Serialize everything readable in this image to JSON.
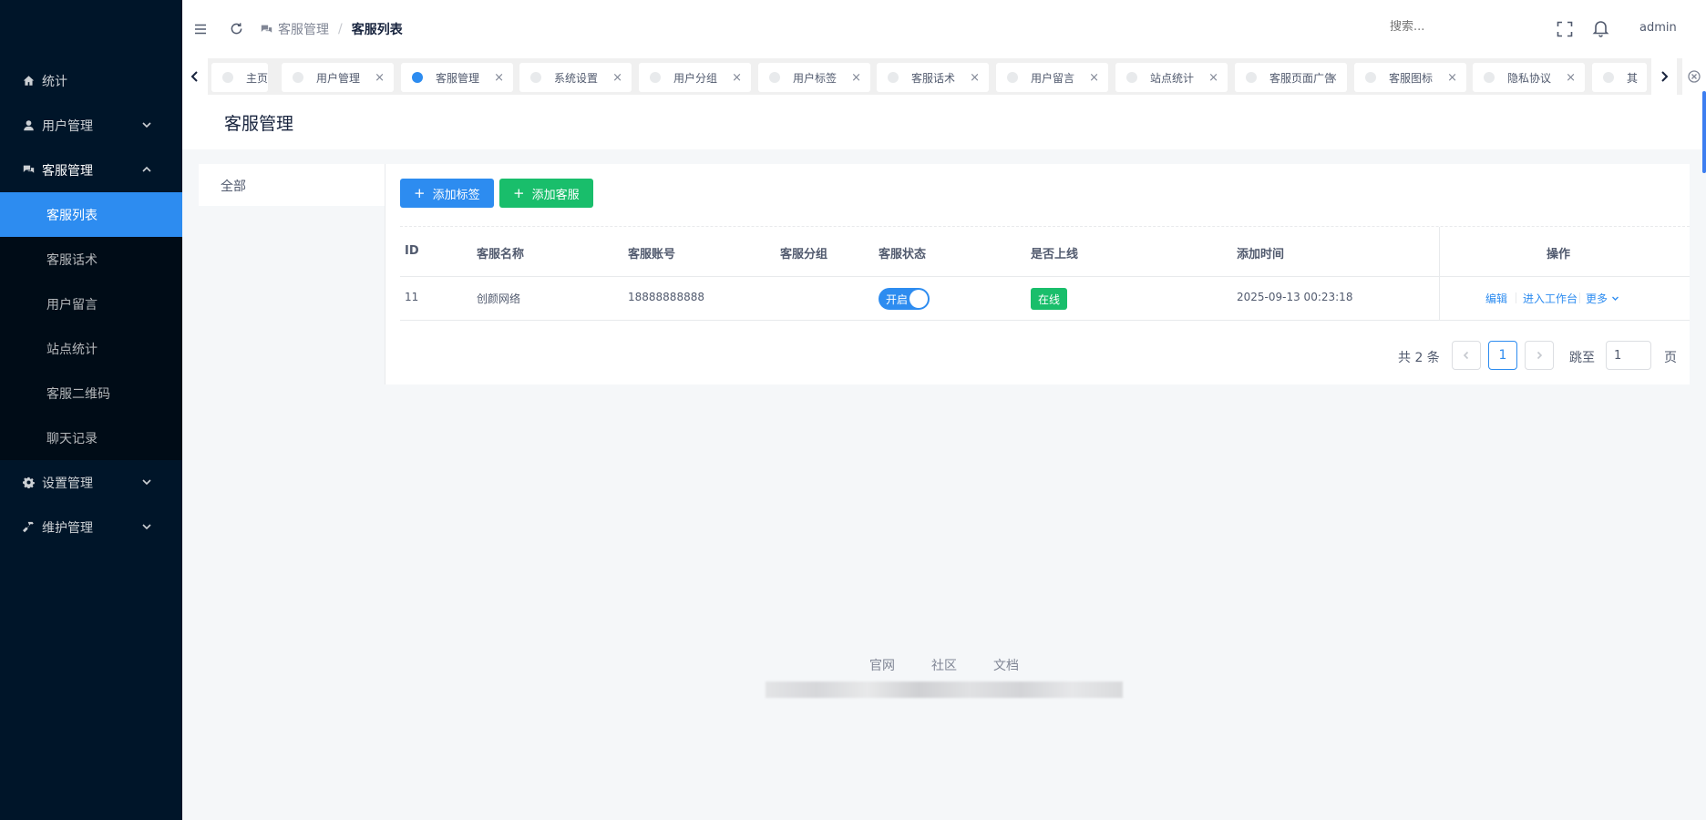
{
  "sidebar": {
    "items": [
      {
        "label": "统计",
        "icon": "home-icon"
      },
      {
        "label": "用户管理",
        "icon": "user-icon"
      },
      {
        "label": "客服管理",
        "icon": "chat-icon"
      },
      {
        "label": "设置管理",
        "icon": "gear-icon"
      },
      {
        "label": "维护管理",
        "icon": "hammer-icon"
      }
    ],
    "sub_items": [
      "客服列表",
      "客服话术",
      "用户留言",
      "站点统计",
      "客服二维码",
      "聊天记录"
    ]
  },
  "header": {
    "breadcrumb": {
      "parent": "客服管理",
      "separator": "/",
      "current": "客服列表"
    },
    "search_placeholder": "搜索...",
    "user": "admin"
  },
  "tabs": [
    "主页",
    "用户管理",
    "客服管理",
    "系统设置",
    "用户分组",
    "用户标签",
    "客服话术",
    "用户留言",
    "站点统计",
    "客服页面广告",
    "客服图标",
    "隐私协议",
    "其"
  ],
  "tab_close_glyph": "×",
  "page": {
    "title": "客服管理"
  },
  "left_panel": {
    "all_label": "全部"
  },
  "toolbar": {
    "add_tag": "添加标签",
    "add_service": "添加客服",
    "plus": "+"
  },
  "table": {
    "columns": [
      "ID",
      "客服名称",
      "客服账号",
      "客服分组",
      "客服状态",
      "是否上线",
      "添加时间",
      "操作"
    ],
    "rows": [
      {
        "id": "11",
        "name": "创颜网络",
        "account": "18888888888",
        "group": "",
        "status": "开启",
        "online": "在线",
        "added": "2025-09-13 00:23:18"
      }
    ],
    "actions": {
      "edit": "编辑",
      "workbench": "进入工作台",
      "more": "更多"
    }
  },
  "pagination": {
    "total": "共 2 条",
    "current_page": "1",
    "jump_label": "跳至",
    "jump_value": "1",
    "page_suffix": "页"
  },
  "footer": {
    "links": [
      "官网",
      "社区",
      "文档"
    ]
  },
  "colors": {
    "primary": "#2d8cf0",
    "success": "#19be6b",
    "sidebar": "#001529",
    "sidebar_sub": "#000c17"
  }
}
